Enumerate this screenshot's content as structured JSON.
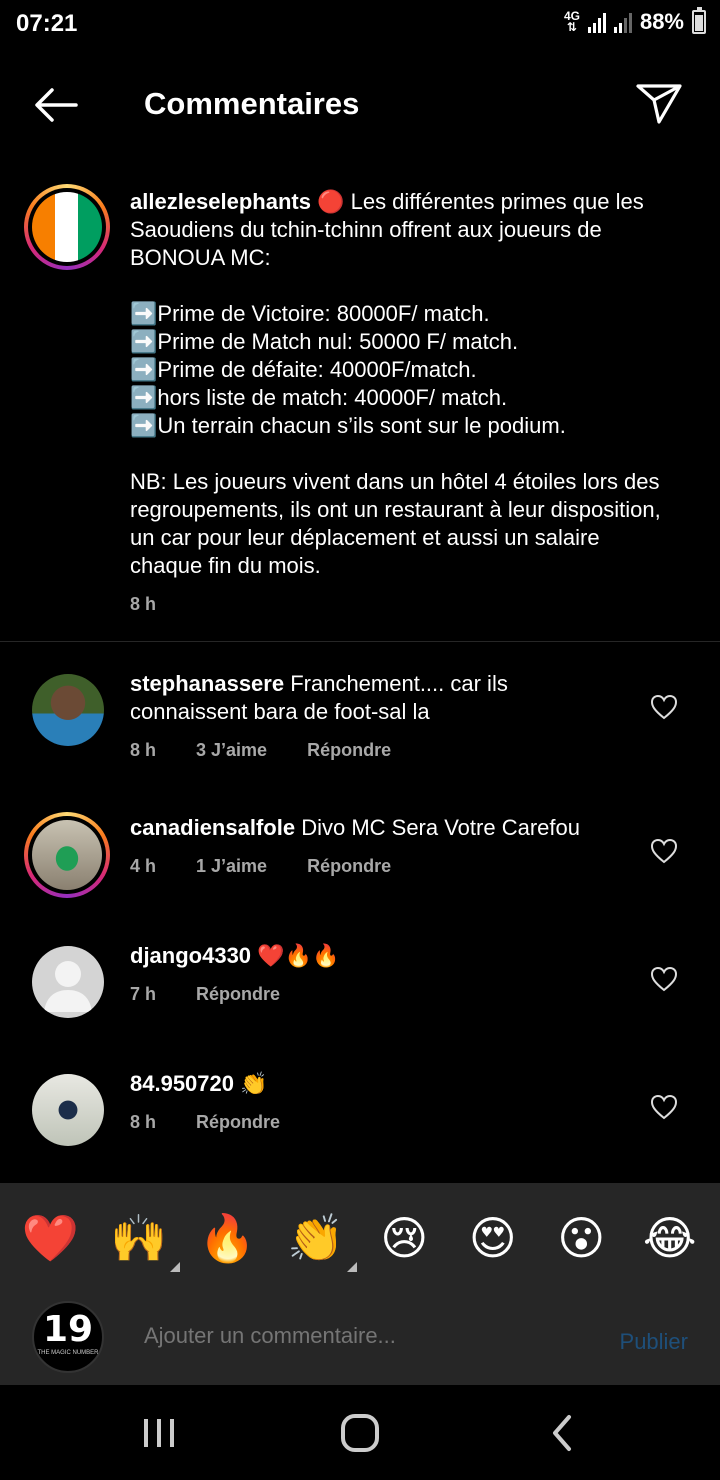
{
  "status_bar": {
    "time": "07:21",
    "network": "4G",
    "battery": "88%"
  },
  "header": {
    "title": "Commentaires"
  },
  "caption": {
    "username": "allezleselephants",
    "text": " 🔴 Les différentes primes que les Saoudiens du tchin-tchinn offrent aux joueurs de BONOUA MC:\n\n➡️Prime de Victoire: 80000F/ match.\n➡️Prime de Match nul: 50000 F/ match.\n➡️Prime de défaite: 40000F/match.\n➡️hors liste de match: 40000F/ match.\n➡️Un terrain chacun s’ils sont sur le podium.\n\nNB: Les joueurs vivent dans un hôtel 4 étoiles lors des regroupements, ils ont un restaurant à leur disposition, un car pour leur déplacement et aussi un salaire chaque fin du mois.",
    "time": "8 h"
  },
  "comments": [
    {
      "username": "stephanassere",
      "text": " Franchement.... car ils connaissent bara de foot-sal la",
      "time": "8 h",
      "likes": "3 J’aime",
      "reply": "Répondre"
    },
    {
      "username": "canadiensalfole",
      "text": " Divo MC Sera Votre Carefou",
      "time": "4 h",
      "likes": "1 J’aime",
      "reply": "Répondre"
    },
    {
      "username": "django4330",
      "text": " ❤️🔥🔥",
      "time": "7 h",
      "reply": "Répondre"
    },
    {
      "username": "84.950720",
      "text": " 👏",
      "time": "8 h",
      "reply": "Répondre"
    }
  ],
  "emoji_bar": [
    "❤️",
    "🙌",
    "🔥",
    "👏",
    "😢",
    "😍",
    "😮",
    "😂"
  ],
  "composer": {
    "avatar_number": "19",
    "avatar_caption": "THE MAGIC NUMBER",
    "placeholder": "Ajouter un commentaire...",
    "publish": "Publier"
  },
  "colors": {
    "background": "#000000",
    "panel": "#262626",
    "secondary_text": "#a8a8a8",
    "publish_disabled": "#1e4f7a"
  }
}
